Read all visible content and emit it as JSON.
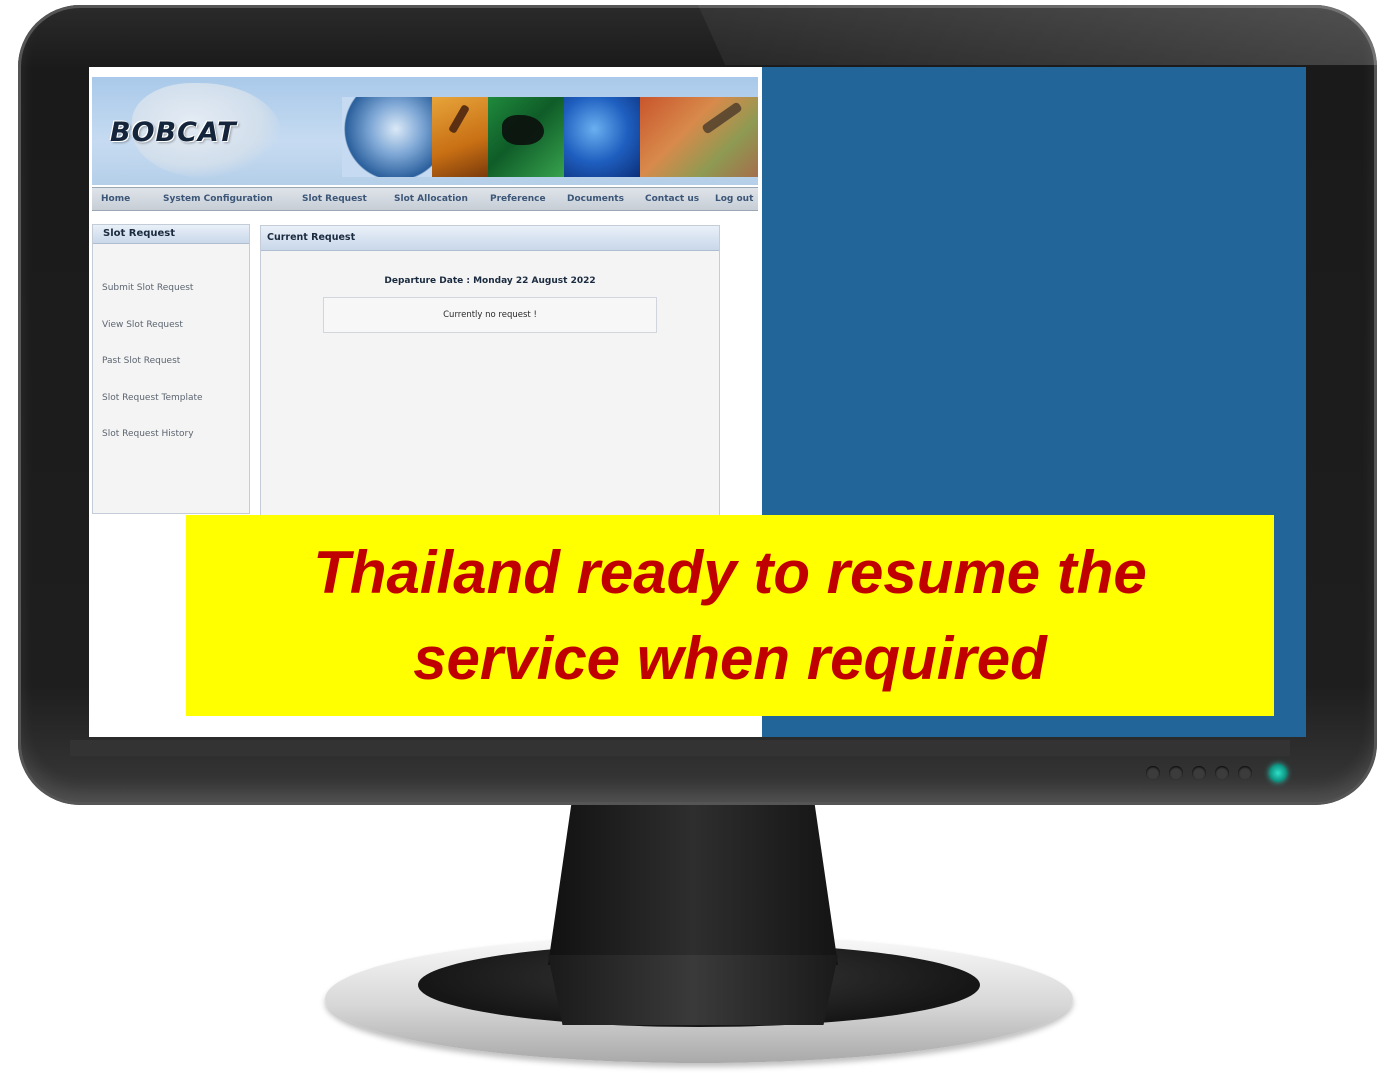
{
  "app": {
    "logo_text": "BOBCAT"
  },
  "nav": {
    "items": [
      "Home",
      "System Configuration",
      "Slot Request",
      "Slot Allocation",
      "Preference",
      "Documents",
      "Contact us",
      "Log out"
    ]
  },
  "sidebar": {
    "title": "Slot Request",
    "items": [
      {
        "label": "Submit Slot Request"
      },
      {
        "label": "View Slot Request"
      },
      {
        "label": "Past Slot Request"
      },
      {
        "label": "Slot Request Template"
      },
      {
        "label": "Slot Request History"
      }
    ]
  },
  "main": {
    "title": "Current Request",
    "departure_date": "Departure Date : Monday 22 August 2022",
    "status_message": "Currently no request !"
  },
  "caption": {
    "line1": "Thailand ready to resume the",
    "line2": "service when required",
    "background_color": "#ffff00",
    "text_color": "#c00000"
  },
  "colors": {
    "desktop_background": "#226699",
    "power_led": "#21c9b2"
  }
}
